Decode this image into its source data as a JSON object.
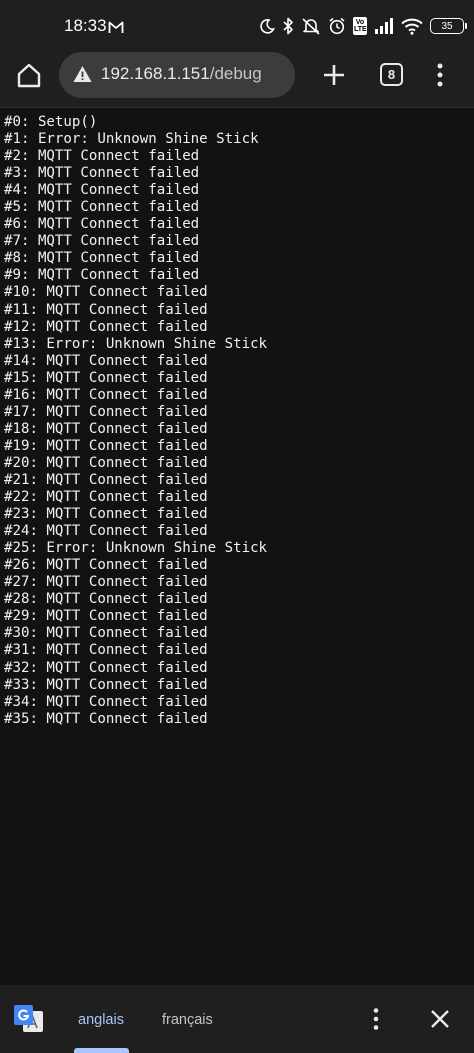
{
  "status_bar": {
    "time": "18:33",
    "volte": "Vo LTE",
    "battery": "35",
    "icons": [
      "mail-icon",
      "moon-icon",
      "bluetooth-icon",
      "bell-off-icon",
      "alarm-icon",
      "volte-icon",
      "signal-icon",
      "wifi-icon",
      "battery-icon"
    ]
  },
  "toolbar": {
    "url_host": "192.168.1.151",
    "url_path": "/debug",
    "tab_count": "8",
    "icons": [
      "home-icon",
      "warning-icon",
      "plus-icon",
      "tabs-icon",
      "more-vert-icon"
    ]
  },
  "log": {
    "lines": [
      "#0: Setup()",
      "#1: Error: Unknown Shine Stick",
      "#2: MQTT Connect failed",
      "#3: MQTT Connect failed",
      "#4: MQTT Connect failed",
      "#5: MQTT Connect failed",
      "#6: MQTT Connect failed",
      "#7: MQTT Connect failed",
      "#8: MQTT Connect failed",
      "#9: MQTT Connect failed",
      "#10: MQTT Connect failed",
      "#11: MQTT Connect failed",
      "#12: MQTT Connect failed",
      "#13: Error: Unknown Shine Stick",
      "#14: MQTT Connect failed",
      "#15: MQTT Connect failed",
      "#16: MQTT Connect failed",
      "#17: MQTT Connect failed",
      "#18: MQTT Connect failed",
      "#19: MQTT Connect failed",
      "#20: MQTT Connect failed",
      "#21: MQTT Connect failed",
      "#22: MQTT Connect failed",
      "#23: MQTT Connect failed",
      "#24: MQTT Connect failed",
      "#25: Error: Unknown Shine Stick",
      "#26: MQTT Connect failed",
      "#27: MQTT Connect failed",
      "#28: MQTT Connect failed",
      "#29: MQTT Connect failed",
      "#30: MQTT Connect failed",
      "#31: MQTT Connect failed",
      "#32: MQTT Connect failed",
      "#33: MQTT Connect failed",
      "#34: MQTT Connect failed",
      "#35: MQTT Connect failed"
    ]
  },
  "translate_bar": {
    "source_language": "anglais",
    "target_language": "français",
    "active_tab": "anglais",
    "icons": [
      "google-translate-icon",
      "more-vert-icon",
      "close-icon"
    ]
  },
  "colors": {
    "background": "#121212",
    "toolbar": "#1f1f1f",
    "omnibox": "#3c3c3c",
    "accent": "#a8c7fa",
    "text": "#f1f1f1"
  }
}
